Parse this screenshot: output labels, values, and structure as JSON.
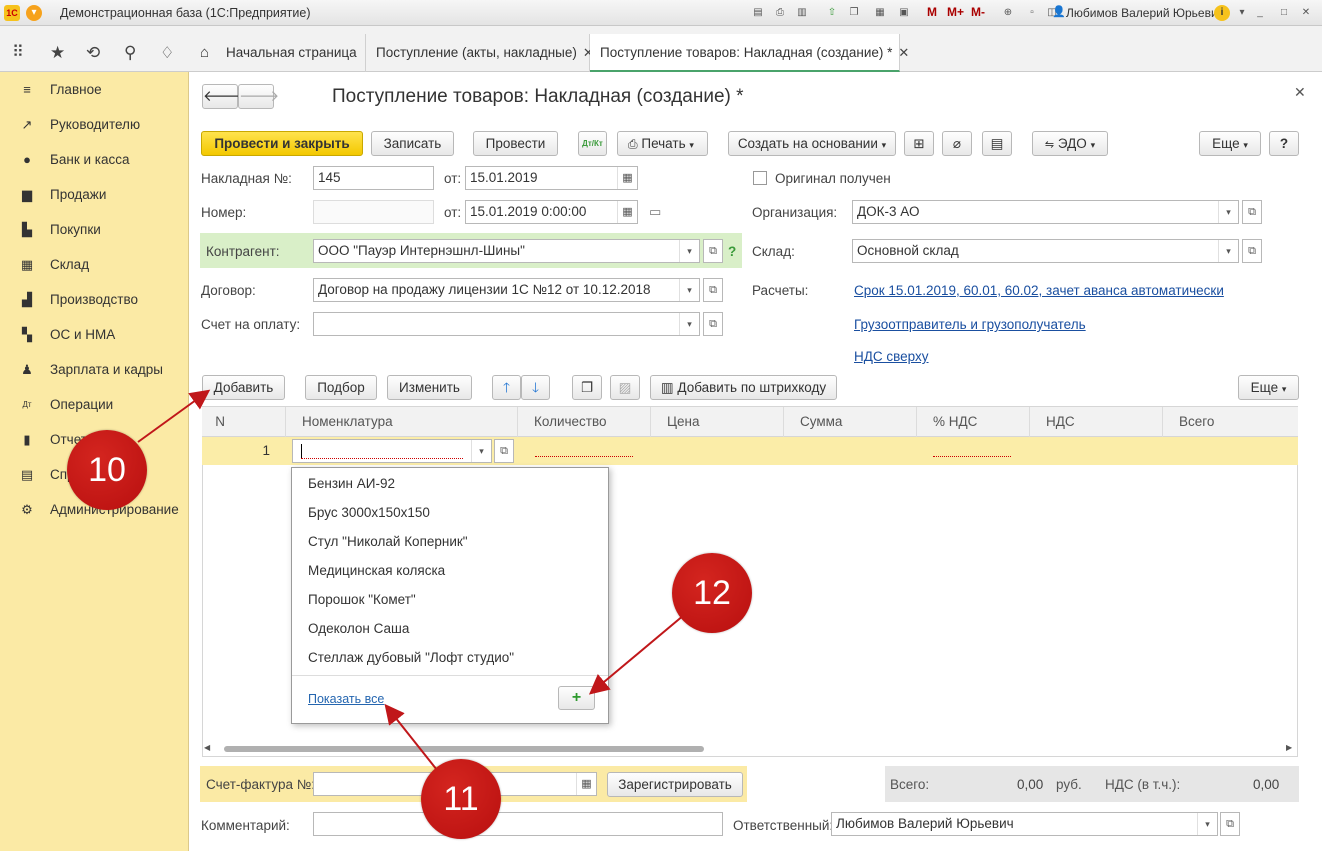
{
  "app": {
    "title": "Демонстрационная база  (1С:Предприятие)",
    "user": "Любимов Валерий Юрьевич",
    "memory_buttons": [
      "M",
      "M+",
      "M-"
    ]
  },
  "tabs": [
    {
      "label": "Начальная страница",
      "closable": false
    },
    {
      "label": "Поступление (акты, накладные)",
      "closable": true
    },
    {
      "label": "Поступление товаров: Накладная (создание) *",
      "closable": true
    }
  ],
  "sidebar": {
    "items": [
      {
        "label": "Главное",
        "icon": "menu-lines-icon"
      },
      {
        "label": "Руководителю",
        "icon": "trend-up-icon"
      },
      {
        "label": "Банк и касса",
        "icon": "coin-icon"
      },
      {
        "label": "Продажи",
        "icon": "cart-icon"
      },
      {
        "label": "Покупки",
        "icon": "basket-icon"
      },
      {
        "label": "Склад",
        "icon": "grid-icon"
      },
      {
        "label": "Производство",
        "icon": "factory-icon"
      },
      {
        "label": "ОС и НМА",
        "icon": "os-icon"
      },
      {
        "label": "Зарплата и кадры",
        "icon": "person-icon"
      },
      {
        "label": "Операции",
        "icon": "dt-kt-icon"
      },
      {
        "label": "Отчеты",
        "icon": "bar-chart-icon"
      },
      {
        "label": "Справочники",
        "icon": "book-icon"
      },
      {
        "label": "Администрирование",
        "icon": "gear-icon"
      }
    ]
  },
  "form": {
    "title": "Поступление товаров: Накладная (создание) *",
    "toolbar": {
      "post_close": "Провести и закрыть",
      "save": "Записать",
      "post": "Провести",
      "print": "Печать",
      "create_based": "Создать на основании",
      "edo": "ЭДО",
      "more": "Еще",
      "help": "?",
      "dtkt": "Дт/Кт"
    },
    "fields": {
      "invoice_label": "Накладная №:",
      "invoice_value": "145",
      "from_label": "от:",
      "invoice_date": "15.01.2019",
      "number_label": "Номер:",
      "number_value": "",
      "number_date": "15.01.2019  0:00:00",
      "original_label": "Оригинал получен",
      "original_checked": false,
      "org_label": "Организация:",
      "org_value": "ДОК-3 АО",
      "contractor_label": "Контрагент:",
      "contractor_value": "ООО \"Пауэр Интернэшнл-Шины\"",
      "warehouse_label": "Склад:",
      "warehouse_value": "Основной склад",
      "contract_label": "Договор:",
      "contract_value": "Договор на продажу лицензии 1С №12 от 10.12.2018",
      "settlements_label": "Расчеты:",
      "settlements_link": "Срок 15.01.2019, 60.01, 60.02, зачет аванса автоматически",
      "payment_label": "Счет на оплату:",
      "payment_value": "",
      "shipper_link": "Грузоотправитель и грузополучатель",
      "vat_link": "НДС сверху",
      "help_q": "?"
    },
    "table_toolbar": {
      "add": "Добавить",
      "pick": "Подбор",
      "edit": "Изменить",
      "barcode": "Добавить по штрихкоду",
      "more": "Еще"
    },
    "table": {
      "columns": [
        "N",
        "Номенклатура",
        "Количество",
        "Цена",
        "Сумма",
        "% НДС",
        "НДС",
        "Всего"
      ],
      "rows": [
        {
          "n": "1",
          "nomenclature": "",
          "qty": "",
          "price": "",
          "sum": "",
          "vat_rate": "",
          "vat": "",
          "total": ""
        }
      ]
    },
    "dropdown": {
      "items": [
        "Бензин АИ-92",
        "Брус 3000х150х150",
        "Стул \"Николай Коперник\"",
        "Медицинская коляска",
        "Порошок \"Комет\"",
        "Одеколон Саша",
        "Стеллаж дубовый \"Лофт студио\""
      ],
      "show_all": "Показать все",
      "add_button": "+"
    },
    "footer": {
      "invoice_label": "Счет-фактура №:",
      "invoice_value": "",
      "register_button": "Зарегистрировать",
      "total_label": "Всего:",
      "total_value": "0,00",
      "currency": "руб.",
      "vat_label": "НДС (в т.ч.):",
      "vat_value": "0,00",
      "comment_label": "Комментарий:",
      "comment_value": "",
      "responsible_label": "Ответственный:",
      "responsible_value": "Любимов Валерий Юрьевич"
    }
  },
  "markers": [
    "10",
    "11",
    "12"
  ],
  "colors": {
    "sidebar_bg": "#fbeaa5",
    "primary_button": "#f3c800",
    "marker_red": "#c0171a",
    "selected_row": "#fbeda8",
    "link": "#1a4fa0",
    "contractor_bg": "#d9efc8"
  }
}
